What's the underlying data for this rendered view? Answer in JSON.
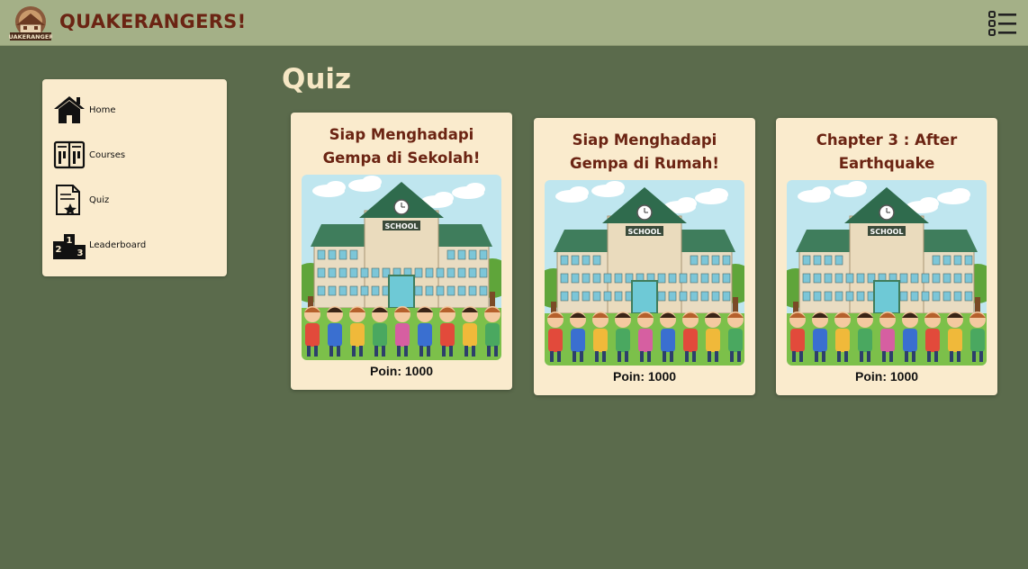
{
  "header": {
    "brand": "QUAKERANGERS!",
    "logo_text": "QUAKERANGERS",
    "logo_icon": "house-logo",
    "menu_icon": "list-menu-icon"
  },
  "sidebar": {
    "items": [
      {
        "label": "Home",
        "icon": "home-icon"
      },
      {
        "label": "Courses",
        "icon": "book-icon"
      },
      {
        "label": "Quiz",
        "icon": "quiz-document-icon"
      },
      {
        "label": "Leaderboard",
        "icon": "podium-icon"
      }
    ]
  },
  "main": {
    "title": "Quiz",
    "cards": [
      {
        "title_line1": "Siap Menghadapi",
        "title_line2": "Gempa di Sekolah!",
        "image_sign": "SCHOOL",
        "points": "Poin: 1000"
      },
      {
        "title_line1": "Siap Menghadapi",
        "title_line2": "Gempa di Rumah!",
        "image_sign": "SCHOOL",
        "points": "Poin: 1000"
      },
      {
        "title_line1": "Chapter 3 : After",
        "title_line2": "Earthquake",
        "image_sign": "SCHOOL",
        "points": "Poin: 1000"
      }
    ]
  },
  "colors": {
    "background": "#5b6b4c",
    "topbar": "#a4b087",
    "panel": "#faebcd",
    "brand": "#6b2413",
    "title": "#f6e7c4"
  }
}
